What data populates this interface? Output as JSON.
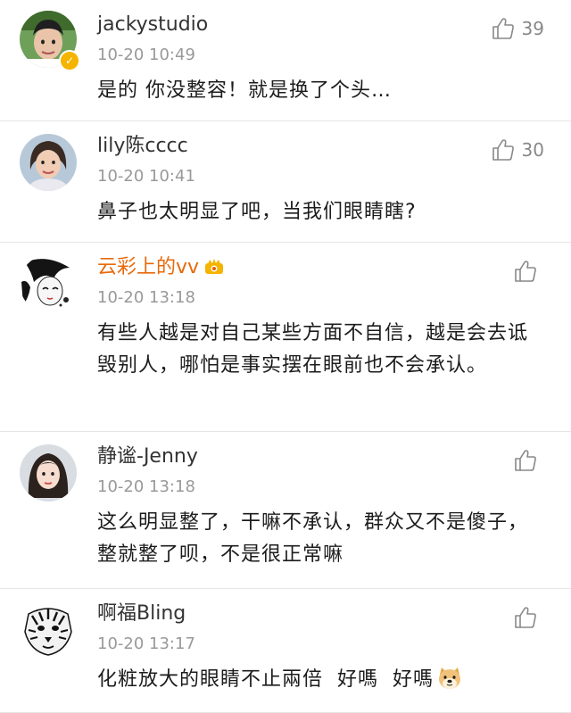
{
  "comments": [
    {
      "username": "jackystudio",
      "timestamp": "10-20 10:49",
      "content": "是的 你没整容！就是换了个头…",
      "likes": "39",
      "verified": true,
      "vip": false,
      "avatar_icon": "young-man-photo"
    },
    {
      "username": "lily陈cccc",
      "timestamp": "10-20 10:41",
      "content": "鼻子也太明显了吧，当我们眼睛瞎?",
      "likes": "30",
      "verified": false,
      "vip": false,
      "avatar_icon": "woman-photo"
    },
    {
      "username": "云彩上的vv",
      "timestamp": "10-20 13:18",
      "content": "有些人越是对自己某些方面不自信，越是会去诋毁别人，哪怕是事实摆在眼前也不会承认。",
      "likes": "",
      "verified": false,
      "vip": true,
      "avatar_icon": "anime-girl-sketch"
    },
    {
      "username": "静谧-Jenny",
      "timestamp": "10-20 13:18",
      "content": "这么明显整了，干嘛不承认，群众又不是傻子，整就整了呗，不是很正常嘛",
      "likes": "",
      "verified": false,
      "vip": false,
      "avatar_icon": "young-woman-photo"
    },
    {
      "username": "啊福Bling",
      "timestamp": "10-20 13:17",
      "content": "化粧放大的眼睛不止兩倍  好嗎  好嗎",
      "likes": "",
      "verified": false,
      "vip": false,
      "avatar_icon": "tiger-illustration",
      "trailing_emoji": "doge-emoji"
    }
  ],
  "colors": {
    "username": "#333333",
    "vip_username": "#e8690a",
    "timestamp": "#999999",
    "content": "#1c1c1c",
    "divider": "#e6e6e6",
    "verified_badge": "#f5b400"
  }
}
